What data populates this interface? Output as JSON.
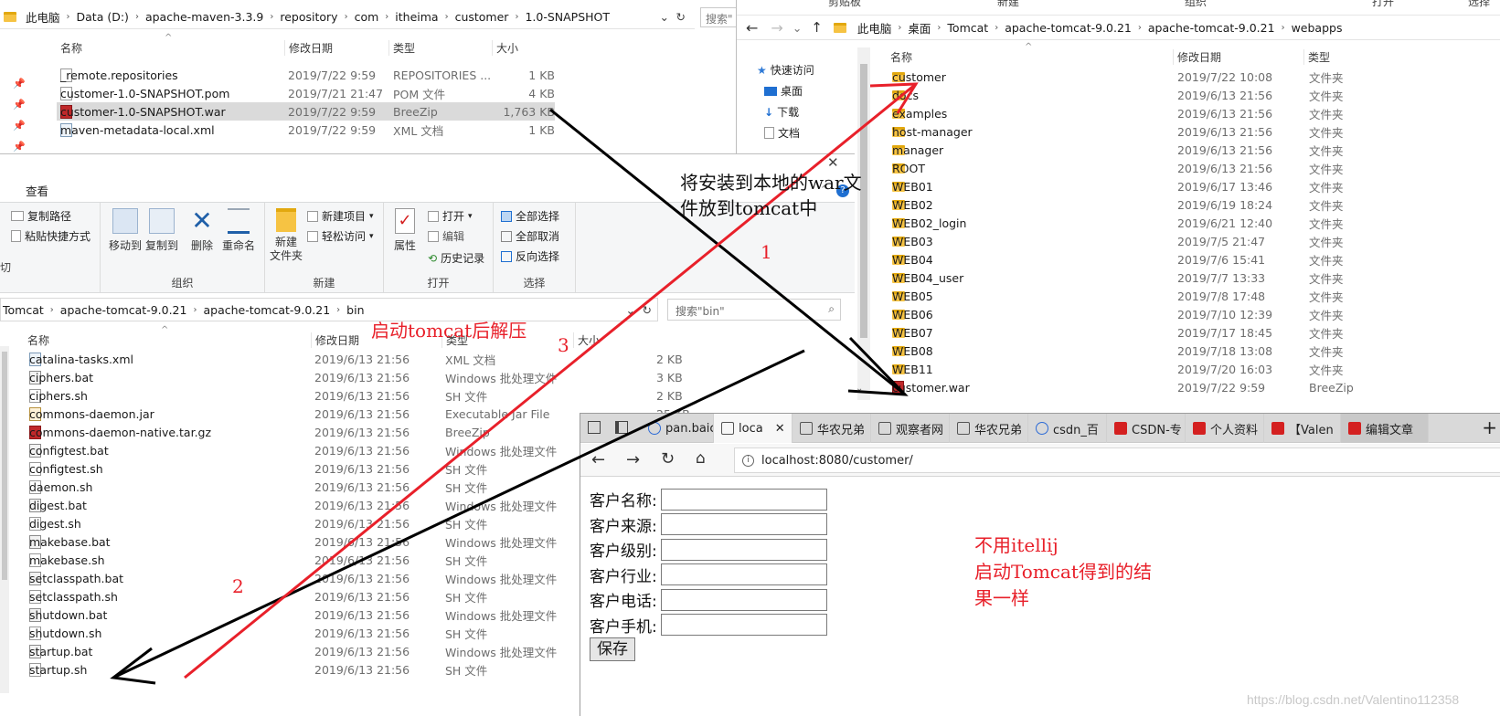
{
  "top_left": {
    "breadcrumb": [
      "此电脑",
      "Data (D:)",
      "apache-maven-3.3.9",
      "repository",
      "com",
      "itheima",
      "customer",
      "1.0-SNAPSHOT"
    ],
    "search_placeholder": "搜索\"",
    "columns": [
      "名称",
      "修改日期",
      "类型",
      "大小"
    ],
    "files": [
      {
        "name": "_remote.repositories",
        "date": "2019/7/22 9:59",
        "type": "REPOSITORIES ...",
        "size": "1 KB",
        "icon": "file-icon"
      },
      {
        "name": "customer-1.0-SNAPSHOT.pom",
        "date": "2019/7/21 21:47",
        "type": "POM 文件",
        "size": "4 KB",
        "icon": "file-icon"
      },
      {
        "name": "customer-1.0-SNAPSHOT.war",
        "date": "2019/7/22 9:59",
        "type": "BreeZip",
        "size": "1,763 KB",
        "icon": "war-icon"
      },
      {
        "name": "maven-metadata-local.xml",
        "date": "2019/7/22 9:59",
        "type": "XML 文档",
        "size": "1 KB",
        "icon": "xml-icon"
      }
    ]
  },
  "right": {
    "ribbon_tabs": [
      "剪贴板",
      "新建",
      "组织",
      "打开",
      "选择"
    ],
    "breadcrumb": [
      "此电脑",
      "桌面",
      "Tomcat",
      "apache-tomcat-9.0.21",
      "apache-tomcat-9.0.21",
      "webapps"
    ],
    "sidebar": [
      "快速访问",
      "桌面",
      "下载",
      "文档"
    ],
    "columns": [
      "名称",
      "修改日期",
      "类型"
    ],
    "files": [
      {
        "name": "customer",
        "date": "2019/7/22 10:08",
        "type": "文件夹"
      },
      {
        "name": "docs",
        "date": "2019/6/13 21:56",
        "type": "文件夹"
      },
      {
        "name": "examples",
        "date": "2019/6/13 21:56",
        "type": "文件夹"
      },
      {
        "name": "host-manager",
        "date": "2019/6/13 21:56",
        "type": "文件夹"
      },
      {
        "name": "manager",
        "date": "2019/6/13 21:56",
        "type": "文件夹"
      },
      {
        "name": "ROOT",
        "date": "2019/6/13 21:56",
        "type": "文件夹"
      },
      {
        "name": "WEB01",
        "date": "2019/6/17 13:46",
        "type": "文件夹"
      },
      {
        "name": "WEB02",
        "date": "2019/6/19 18:24",
        "type": "文件夹"
      },
      {
        "name": "WEB02_login",
        "date": "2019/6/21 12:40",
        "type": "文件夹"
      },
      {
        "name": "WEB03",
        "date": "2019/7/5 21:47",
        "type": "文件夹"
      },
      {
        "name": "WEB04",
        "date": "2019/7/6 15:41",
        "type": "文件夹"
      },
      {
        "name": "WEB04_user",
        "date": "2019/7/7 13:33",
        "type": "文件夹"
      },
      {
        "name": "WEB05",
        "date": "2019/7/8 17:48",
        "type": "文件夹"
      },
      {
        "name": "WEB06",
        "date": "2019/7/10 12:39",
        "type": "文件夹"
      },
      {
        "name": "WEB07",
        "date": "2019/7/17 18:45",
        "type": "文件夹"
      },
      {
        "name": "WEB08",
        "date": "2019/7/18 13:08",
        "type": "文件夹"
      },
      {
        "name": "WEB11",
        "date": "2019/7/20 16:03",
        "type": "文件夹"
      },
      {
        "name": "customer.war",
        "date": "2019/7/22 9:59",
        "type": "BreeZip"
      }
    ]
  },
  "bin": {
    "ribbon_tab": "查看",
    "ribbon": {
      "copy_path": "复制路径",
      "paste_shortcut": "粘贴快捷方式",
      "move_to": "移动到",
      "copy_to": "复制到",
      "delete": "删除",
      "rename": "重命名",
      "new_folder": "新建\n文件夹",
      "new_item": "新建项目",
      "easy_access": "轻松访问",
      "properties": "属性",
      "open": "打开",
      "edit": "编辑",
      "history": "历史记录",
      "select_all": "全部选择",
      "select_none": "全部取消",
      "invert": "反向选择",
      "groups": [
        "组织",
        "新建",
        "打开",
        "选择"
      ]
    },
    "breadcrumb": [
      "Tomcat",
      "apache-tomcat-9.0.21",
      "apache-tomcat-9.0.21",
      "bin"
    ],
    "search_placeholder": "搜索\"bin\"",
    "columns": [
      "名称",
      "修改日期",
      "类型",
      "大小"
    ],
    "files": [
      {
        "name": "catalina-tasks.xml",
        "date": "2019/6/13 21:56",
        "type": "XML 文档",
        "size": "2 KB",
        "icon": "xml-icon"
      },
      {
        "name": "ciphers.bat",
        "date": "2019/6/13 21:56",
        "type": "Windows 批处理文件",
        "size": "3 KB",
        "icon": "bat-icon"
      },
      {
        "name": "ciphers.sh",
        "date": "2019/6/13 21:56",
        "type": "SH 文件",
        "size": "2 KB",
        "icon": "file-icon"
      },
      {
        "name": "commons-daemon.jar",
        "date": "2019/6/13 21:56",
        "type": "Executable Jar File",
        "size": "25 KB",
        "icon": "jar-icon"
      },
      {
        "name": "commons-daemon-native.tar.gz",
        "date": "2019/6/13 21:56",
        "type": "BreeZip",
        "size": "",
        "icon": "war-icon"
      },
      {
        "name": "configtest.bat",
        "date": "2019/6/13 21:56",
        "type": "Windows 批处理文件",
        "size": "",
        "icon": "bat-icon"
      },
      {
        "name": "configtest.sh",
        "date": "2019/6/13 21:56",
        "type": "SH 文件",
        "size": "",
        "icon": "file-icon"
      },
      {
        "name": "daemon.sh",
        "date": "2019/6/13 21:56",
        "type": "SH 文件",
        "size": "",
        "icon": "file-icon"
      },
      {
        "name": "digest.bat",
        "date": "2019/6/13 21:56",
        "type": "Windows 批处理文件",
        "size": "",
        "icon": "bat-icon"
      },
      {
        "name": "digest.sh",
        "date": "2019/6/13 21:56",
        "type": "SH 文件",
        "size": "",
        "icon": "file-icon"
      },
      {
        "name": "makebase.bat",
        "date": "2019/6/13 21:56",
        "type": "Windows 批处理文件",
        "size": "",
        "icon": "bat-icon"
      },
      {
        "name": "makebase.sh",
        "date": "2019/6/13 21:56",
        "type": "SH 文件",
        "size": "",
        "icon": "file-icon"
      },
      {
        "name": "setclasspath.bat",
        "date": "2019/6/13 21:56",
        "type": "Windows 批处理文件",
        "size": "",
        "icon": "bat-icon"
      },
      {
        "name": "setclasspath.sh",
        "date": "2019/6/13 21:56",
        "type": "SH 文件",
        "size": "",
        "icon": "file-icon"
      },
      {
        "name": "shutdown.bat",
        "date": "2019/6/13 21:56",
        "type": "Windows 批处理文件",
        "size": "",
        "icon": "bat-icon"
      },
      {
        "name": "shutdown.sh",
        "date": "2019/6/13 21:56",
        "type": "SH 文件",
        "size": "",
        "icon": "file-icon"
      },
      {
        "name": "startup.bat",
        "date": "2019/6/13 21:56",
        "type": "Windows 批处理文件",
        "size": "",
        "icon": "bat-icon"
      },
      {
        "name": "startup.sh",
        "date": "2019/6/13 21:56",
        "type": "SH 文件",
        "size": "",
        "icon": "file-icon"
      }
    ]
  },
  "browser": {
    "tabs": [
      "pan.baic",
      "loca",
      "华农兄弟",
      "观察者网",
      "华农兄弟",
      "csdn_百",
      "CSDN-专",
      "个人资料",
      "【Valen",
      "编辑文章"
    ],
    "url": "localhost:8080/customer/",
    "form_labels": [
      "客户名称:",
      "客户来源:",
      "客户级别:",
      "客户行业:",
      "客户电话:",
      "客户手机:"
    ],
    "save_button": "保存"
  },
  "annotations": {
    "note1": "将安装到本地的war文",
    "note1b": "件放到tomcat中",
    "note2": "启动tomcat后解压",
    "note3": "不用itellij",
    "note3b": "启动Tomcat得到的结",
    "note3c": "果一样",
    "num1": "1",
    "num2": "2",
    "num3": "3",
    "watermark": "https://blog.csdn.net/Valentino112358"
  },
  "colors": {
    "annotation_red": "#e8202a",
    "folder": "#f6c343",
    "select": "#dadada"
  }
}
